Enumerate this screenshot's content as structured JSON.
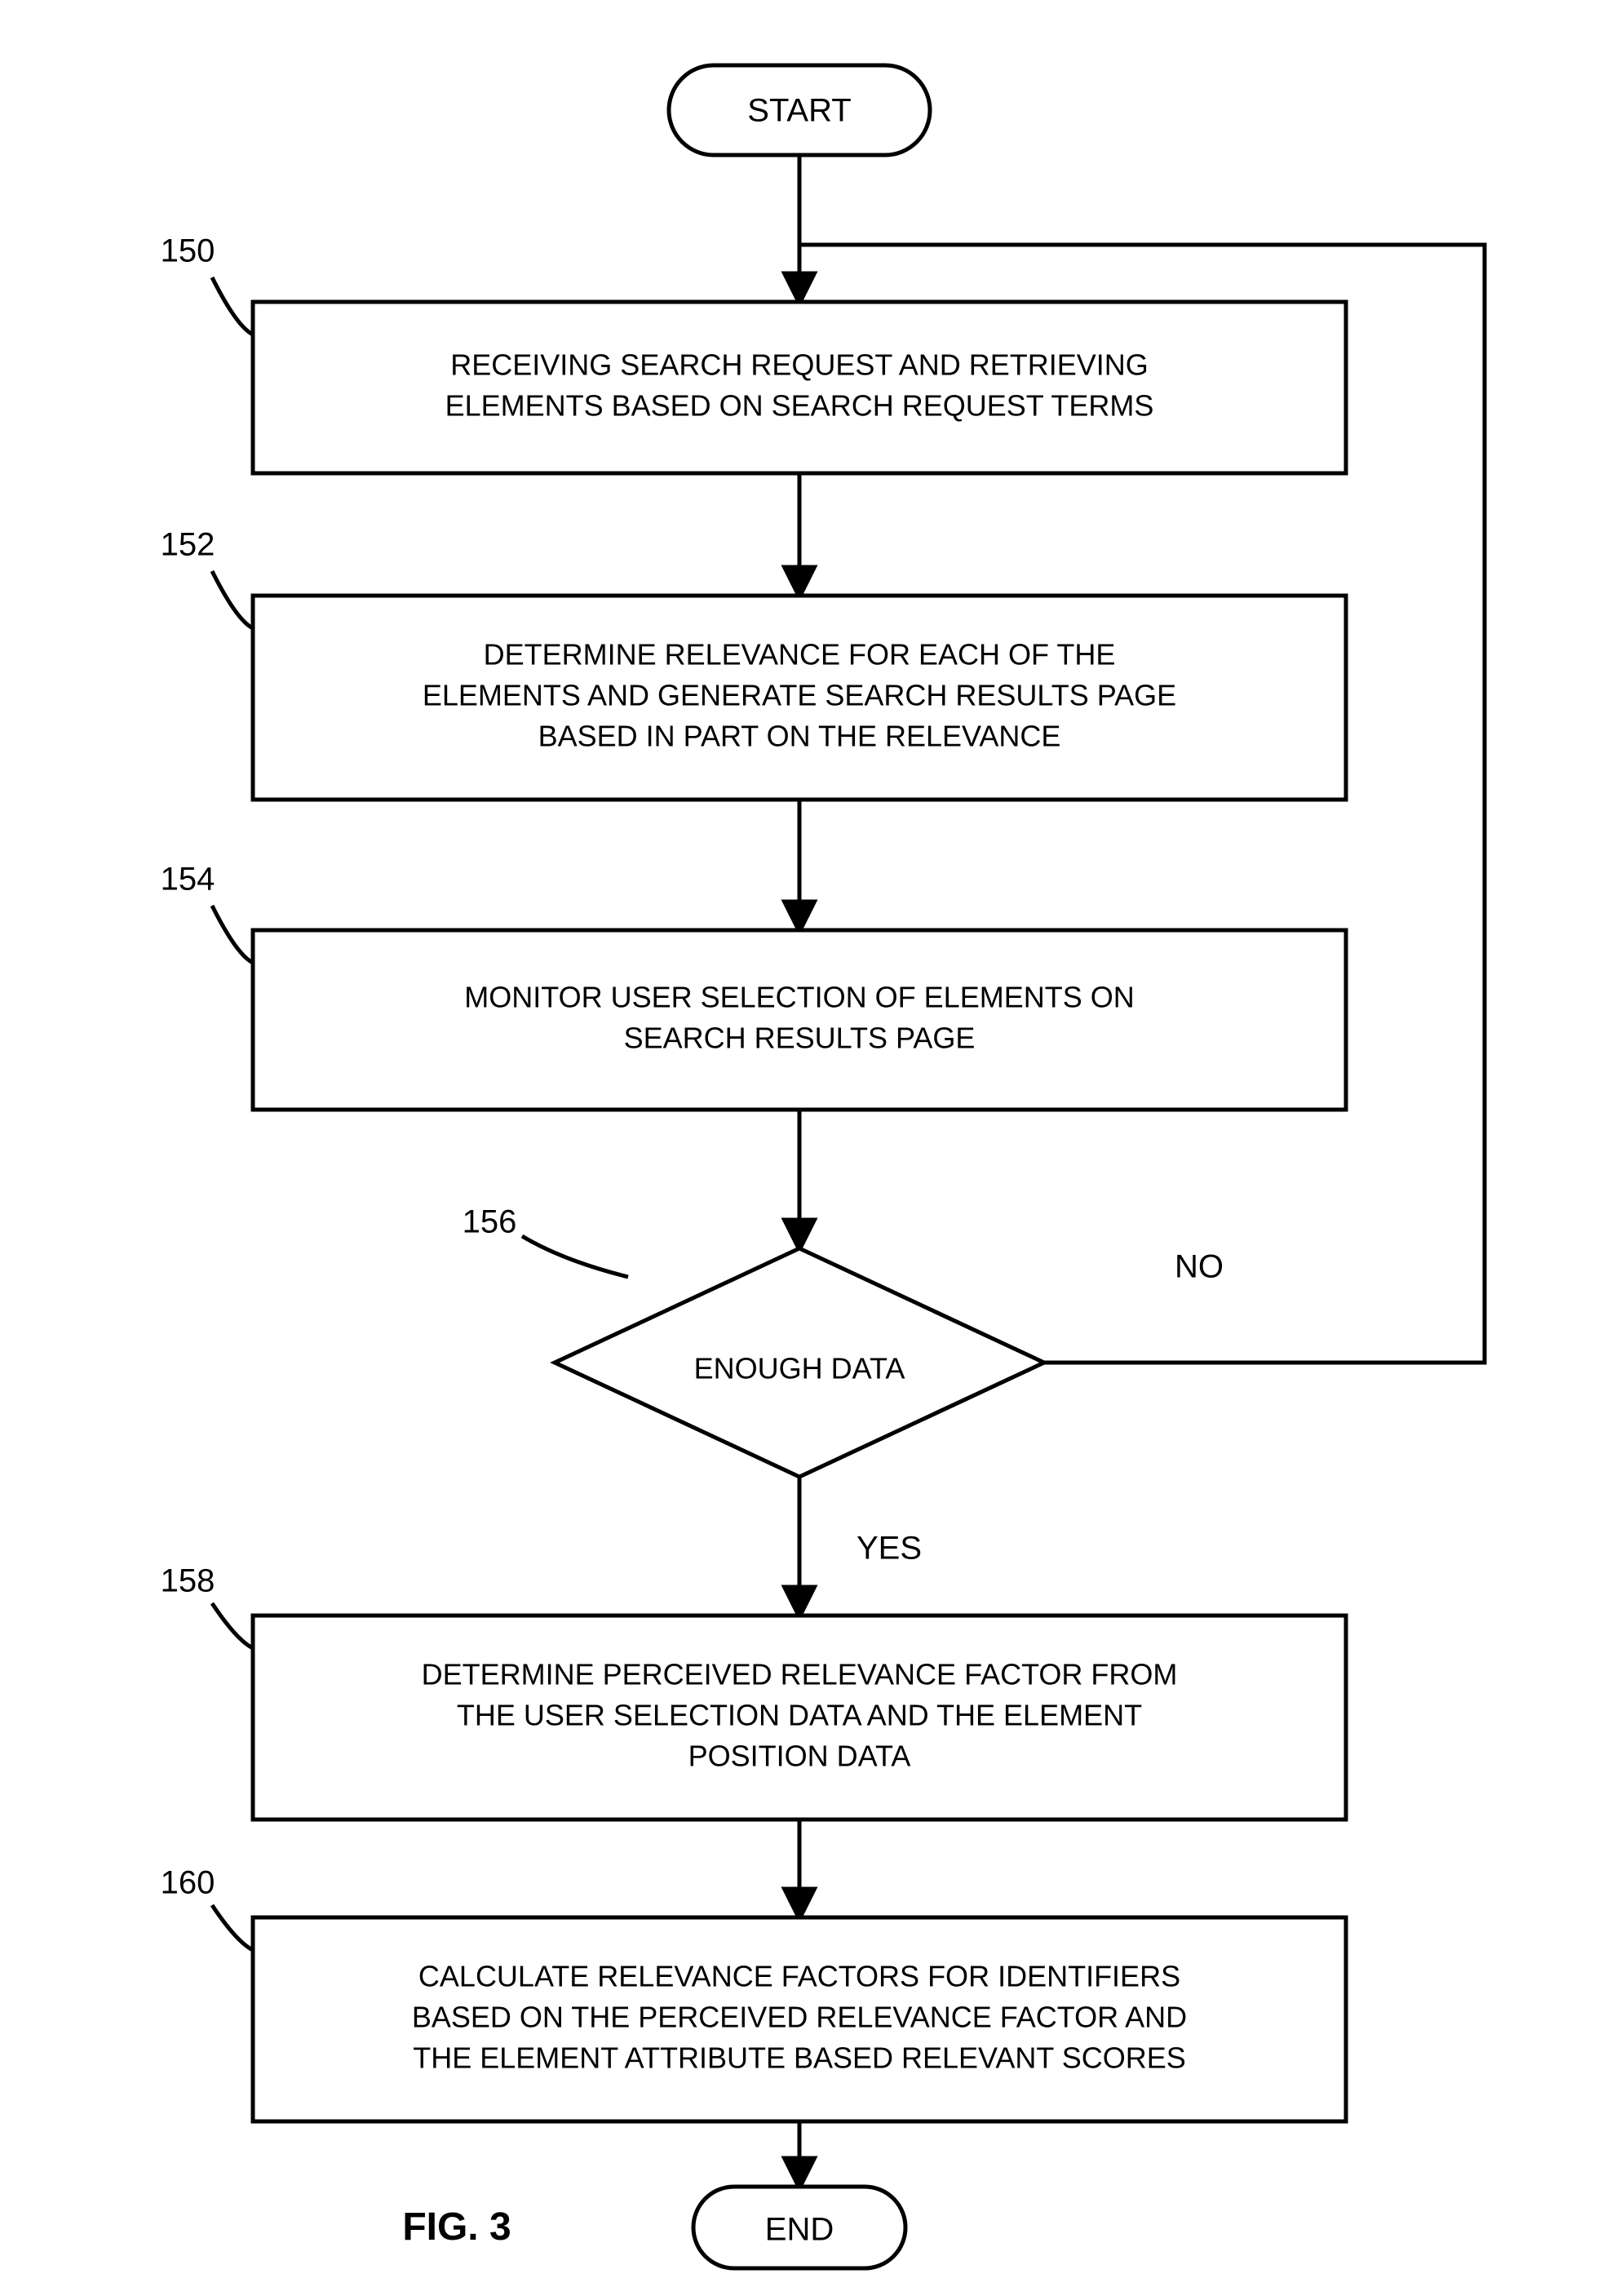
{
  "start": "START",
  "end": "END",
  "figure": "FIG. 3",
  "labels": {
    "b150": "150",
    "b152": "152",
    "b154": "154",
    "b156": "156",
    "b158": "158",
    "b160": "160"
  },
  "boxes": {
    "b150": [
      "RECEIVING SEARCH REQUEST AND RETRIEVING",
      "ELEMENTS BASED ON SEARCH REQUEST TERMS"
    ],
    "b152": [
      "DETERMINE RELEVANCE FOR EACH OF THE",
      "ELEMENTS AND GENERATE SEARCH RESULTS PAGE",
      "BASED IN PART ON THE RELEVANCE"
    ],
    "b154": [
      "MONITOR USER SELECTION OF ELEMENTS ON",
      "SEARCH RESULTS PAGE"
    ],
    "b156": "ENOUGH DATA",
    "b158": [
      "DETERMINE PERCEIVED RELEVANCE FACTOR FROM",
      "THE USER SELECTION DATA AND THE ELEMENT",
      "POSITION DATA"
    ],
    "b160": [
      "CALCULATE RELEVANCE FACTORS FOR IDENTIFIERS",
      "BASED ON THE PERCEIVED RELEVANCE FACTOR AND",
      "THE ELEMENT ATTRIBUTE BASED RELEVANT SCORES"
    ]
  },
  "branches": {
    "no": "NO",
    "yes": "YES"
  }
}
